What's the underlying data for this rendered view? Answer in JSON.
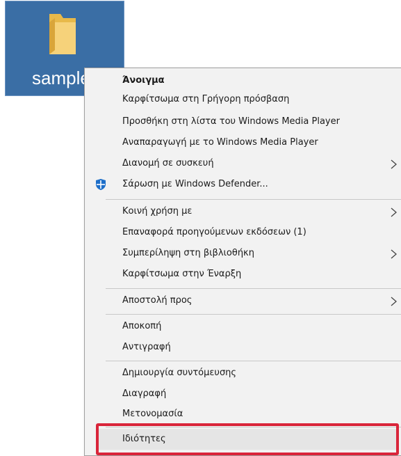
{
  "desktop": {
    "folder": {
      "label": "sample",
      "icon": "folder-icon",
      "selected": true
    }
  },
  "context_menu": {
    "items": [
      {
        "label": "Άνοιγμα",
        "bold": true
      },
      {
        "label": "Καρφίτσωμα στη Γρήγορη πρόσβαση"
      },
      {
        "label": "Προσθήκη στη λίστα του Windows Media Player"
      },
      {
        "label": "Αναπαραγωγή με το Windows Media Player"
      },
      {
        "label": "Διανομή σε συσκευή",
        "submenu": true
      },
      {
        "label": "Σάρωση με Windows Defender...",
        "icon": "windows-defender-icon"
      },
      {
        "label": "Κοινή χρήση με",
        "submenu": true
      },
      {
        "label": "Επαναφορά προηγούμενων εκδόσεων (1)"
      },
      {
        "label": "Συμπερίληψη στη βιβλιοθήκη",
        "submenu": true
      },
      {
        "label": "Καρφίτσωμα στην Έναρξη"
      },
      {
        "label": "Αποστολή προς",
        "submenu": true
      },
      {
        "label": "Αποκοπή"
      },
      {
        "label": "Αντιγραφή"
      },
      {
        "label": "Δημιουργία συντόμευσης"
      },
      {
        "label": "Διαγραφή"
      },
      {
        "label": "Μετονομασία"
      },
      {
        "label": "Ιδιότητες",
        "highlighted": true
      }
    ]
  },
  "colors": {
    "selection_tile": "#3a6ea5",
    "menu_background": "#f2f2f2",
    "highlight_frame": "#d9253a"
  }
}
